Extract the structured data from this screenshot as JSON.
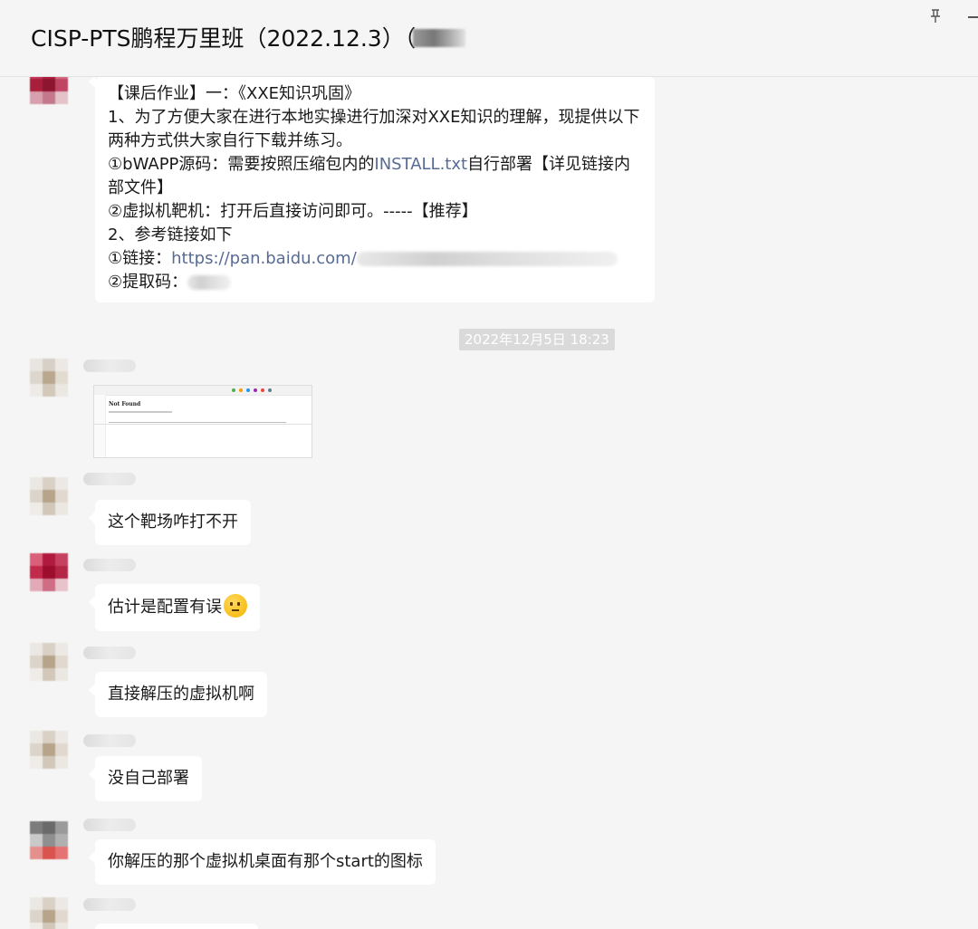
{
  "window": {
    "title": "CISP-PTS鹏程万里班（2022.12.3）（",
    "pin_icon": "pin-icon",
    "minimize_icon": "minimize-icon"
  },
  "messages": {
    "assignment": {
      "line1": "【课后作业】一：《XXE知识巩固》",
      "line2": "  1、为了方便大家在进行本地实操进行加深对XXE知识的理解，现提供以下两种方式供大家自行下载并练习。",
      "line3_prefix": "  ①bWAPP源码：需要按照压缩包内的",
      "line3_link": "INSTALL.txt",
      "line3_suffix": "自行部署【详见链接内部文件】",
      "line4": "  ②虚拟机靶机：打开后直接访问即可。-----【推荐】",
      "line5": "  2、参考链接如下",
      "line6_prefix": "   ①链接：",
      "line6_link": "https://pan.baidu.com/",
      "line7_prefix": "   ②提取码："
    },
    "timestamp": "2022年12月5日 18:23",
    "screenshot_heading": "Not Found",
    "msg1": "这个靶场咋打不开",
    "msg2": "估计是配置有误",
    "msg3": "直接解压的虚拟机啊",
    "msg4": "没自己部署",
    "msg5": "你解压的那个虚拟机桌面有那个start的图标"
  },
  "colors": {
    "background": "#f5f5f5",
    "bubble": "#ffffff",
    "link": "#576b95",
    "timestamp_bg": "#dadada"
  }
}
